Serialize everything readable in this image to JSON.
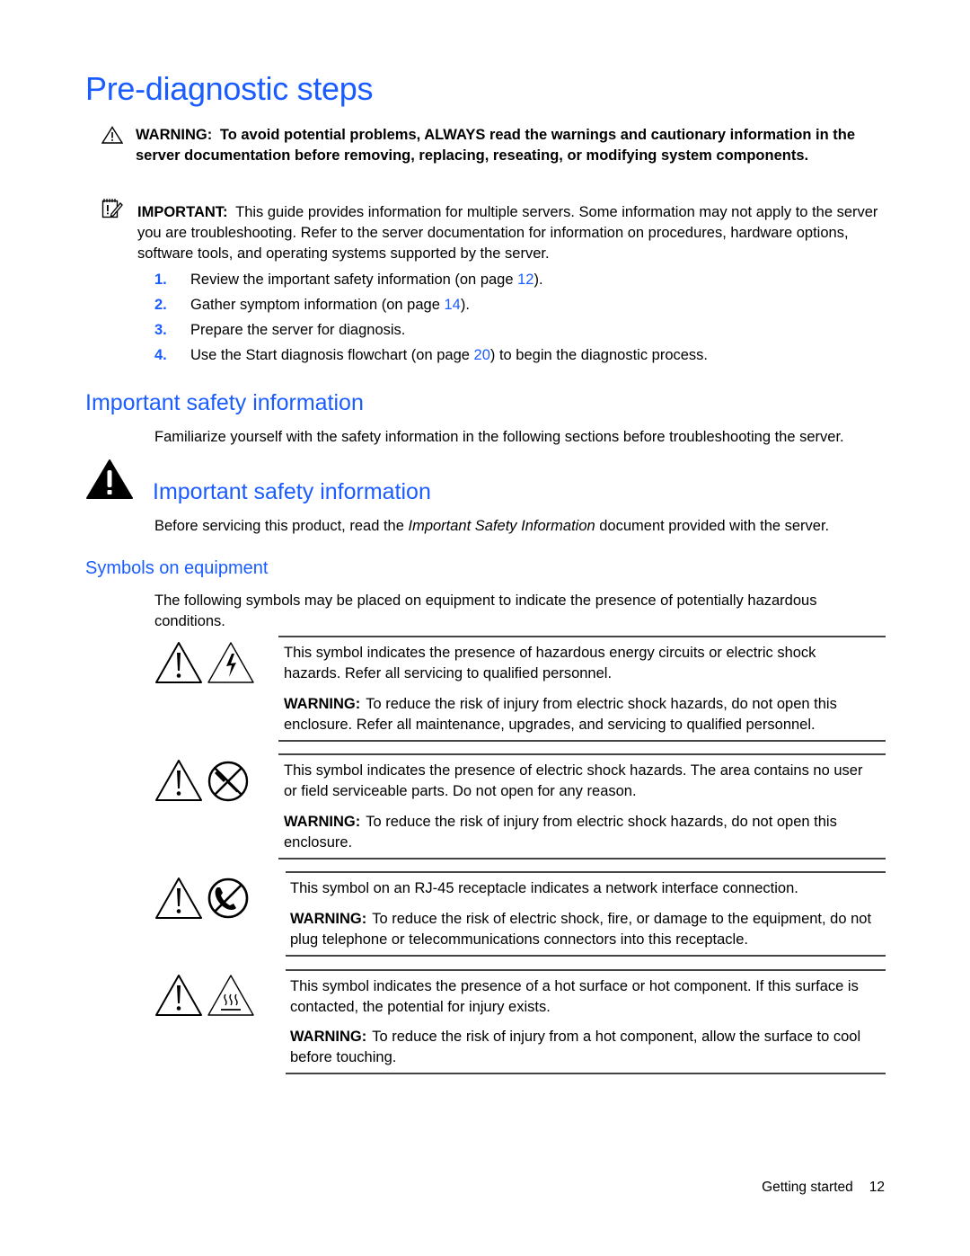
{
  "page": {
    "title": "Pre-diagnostic steps",
    "warning_note": {
      "icon": "warning-triangle-outline-icon",
      "label": "WARNING:",
      "text": "To avoid potential problems, ALWAYS read the warnings and cautionary information in the server documentation before removing, replacing, reseating, or modifying system components."
    },
    "important_note": {
      "icon": "important-note-icon",
      "label": "IMPORTANT:",
      "text": "This guide provides information for multiple servers. Some information may not apply to the server you are troubleshooting. Refer to the server documentation for information on procedures, hardware options, software tools, and operating systems supported by the server."
    },
    "steps": [
      {
        "num": "1.",
        "before": "Review the important safety information (on page ",
        "link": "12",
        "after": ")."
      },
      {
        "num": "2.",
        "before": "Gather symptom information (on page ",
        "link": "14",
        "after": ")."
      },
      {
        "num": "3.",
        "before": "Prepare the server for diagnosis.",
        "link": "",
        "after": ""
      },
      {
        "num": "4.",
        "before": "Use the Start diagnosis flowchart (on page ",
        "link": "20",
        "after": ") to begin the diagnostic process."
      }
    ],
    "section_safety": {
      "heading": "Important safety information",
      "intro": "Familiarize yourself with the safety information in the following sections before troubleshooting the server."
    },
    "subsection_safety": {
      "icon": "warning-triangle-filled-icon",
      "heading": "Important safety information",
      "text_before": "Before servicing this product, read the ",
      "text_italic": "Important Safety Information",
      "text_after": " document provided with the server."
    },
    "symbols_section": {
      "heading": "Symbols on equipment",
      "intro": "The following symbols may be placed on equipment to indicate the presence of potentially hazardous conditions.",
      "rows": [
        {
          "icons": [
            "exclamation-triangle-icon",
            "electric-shock-triangle-icon"
          ],
          "description": "This symbol indicates the presence of hazardous energy circuits or electric shock hazards. Refer all servicing to qualified personnel.",
          "warning_label": "WARNING:",
          "warning_text": "To reduce the risk of injury from electric shock hazards, do not open this enclosure. Refer all maintenance, upgrades, and servicing to qualified personnel."
        },
        {
          "icons": [
            "exclamation-triangle-icon",
            "no-tools-circle-icon"
          ],
          "description": "This symbol indicates the presence of electric shock hazards. The area contains no user or field serviceable parts. Do not open for any reason.",
          "warning_label": "WARNING:",
          "warning_text": "To reduce the risk of injury from electric shock hazards, do not open this enclosure."
        },
        {
          "icons": [
            "exclamation-triangle-icon",
            "no-telephone-circle-icon"
          ],
          "description": "This symbol on an RJ-45 receptacle indicates a network interface connection.",
          "warning_label": "WARNING:",
          "warning_text": "To reduce the risk of electric shock, fire, or damage to the equipment, do not plug telephone or telecommunications connectors into this receptacle."
        },
        {
          "icons": [
            "exclamation-triangle-icon",
            "hot-surface-triangle-icon"
          ],
          "description": "This symbol indicates the presence of a hot surface or hot component. If this surface is contacted, the potential for injury exists.",
          "warning_label": "WARNING:",
          "warning_text": "To reduce the risk of injury from a hot component, allow the surface to cool before touching."
        }
      ]
    },
    "footer": {
      "section": "Getting started",
      "page_number": "12"
    }
  }
}
